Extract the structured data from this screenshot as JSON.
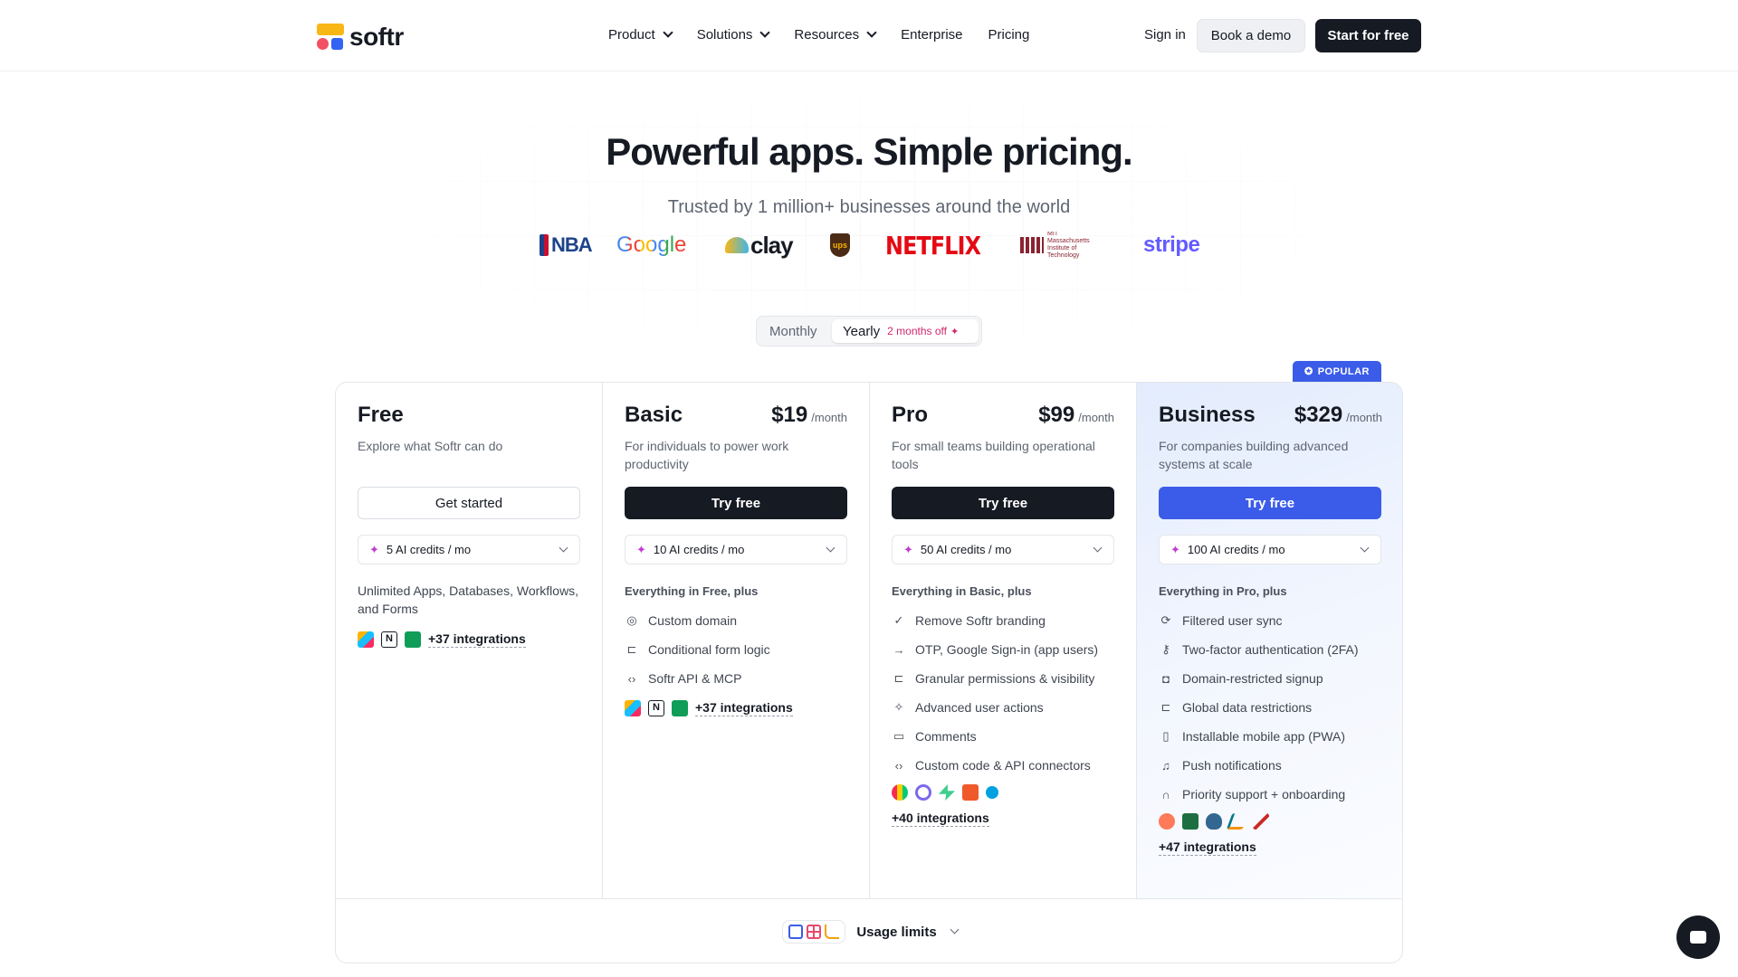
{
  "nav": {
    "logo_text": "softr",
    "menu": [
      {
        "label": "Product",
        "dropdown": true
      },
      {
        "label": "Solutions",
        "dropdown": true
      },
      {
        "label": "Resources",
        "dropdown": true
      },
      {
        "label": "Enterprise",
        "dropdown": false
      },
      {
        "label": "Pricing",
        "dropdown": false
      }
    ],
    "sign_in": "Sign in",
    "book_demo": "Book a demo",
    "start_free": "Start for free"
  },
  "hero": {
    "title": "Powerful apps. Simple pricing.",
    "subtitle": "Trusted by 1 million+ businesses around the world",
    "logos": [
      "NBA",
      "Google",
      "clay",
      "ups",
      "NETFLIX",
      "MIT Massachusetts Institute of Technology",
      "stripe"
    ]
  },
  "billing_toggle": {
    "monthly": "Monthly",
    "yearly": "Yearly",
    "yearly_badge": "2 months off",
    "selected": "Yearly"
  },
  "popular_badge": "POPULAR",
  "plans": [
    {
      "name": "Free",
      "price": "",
      "per": "",
      "description": "Explore what Softr can do",
      "cta": "Get started",
      "credits": "5 AI credits / mo",
      "includes_label": "",
      "summary": "Unlimited Apps, Databases, Workflows, and Forms",
      "features": [],
      "integrations": "+37 integrations"
    },
    {
      "name": "Basic",
      "price": "$19",
      "per": "/month",
      "description": "For individuals to power work productivity",
      "cta": "Try free",
      "credits": "10 AI credits / mo",
      "includes_label": "Everything in Free, plus",
      "features": [
        "Custom domain",
        "Conditional form logic",
        "Softr API & MCP"
      ],
      "integrations": "+37 integrations"
    },
    {
      "name": "Pro",
      "price": "$99",
      "per": "/month",
      "description": "For small teams building operational tools",
      "cta": "Try free",
      "credits": "50 AI credits / mo",
      "includes_label": "Everything in Basic, plus",
      "features": [
        "Remove Softr branding",
        "OTP, Google Sign-in (app users)",
        "Granular permissions & visibility",
        "Advanced user actions",
        "Comments",
        "Custom code & API connectors"
      ],
      "integrations": "+40 integrations"
    },
    {
      "name": "Business",
      "price": "$329",
      "per": "/month",
      "description": "For companies building advanced systems at scale",
      "cta": "Try free",
      "credits": "100 AI credits / mo",
      "includes_label": "Everything in Pro, plus",
      "features": [
        "Filtered user sync",
        "Two-factor authentication (2FA)",
        "Domain-restricted signup",
        "Global data restrictions",
        "Installable mobile app (PWA)",
        "Push notifications",
        "Priority support + onboarding"
      ],
      "integrations": "+47 integrations"
    }
  ],
  "usage_limits": "Usage limits",
  "colors": {
    "brand_dark": "#161a23",
    "brand_blue": "#3b5ce9",
    "accent_pink": "#d1266b",
    "logo_yellow": "#f9b716",
    "logo_red": "#f25164",
    "logo_blue": "#3263f2"
  },
  "icons": {
    "basic_features": [
      "globe-icon",
      "form-logic-icon",
      "code-icon"
    ],
    "pro_features": [
      "badge-check-icon",
      "sign-in-icon",
      "permissions-icon",
      "cursor-click-icon",
      "comments-icon",
      "code-icon"
    ],
    "business_features": [
      "sync-icon",
      "key-icon",
      "lock-icon",
      "restrictions-icon",
      "mobile-icon",
      "bell-icon",
      "headset-icon"
    ]
  }
}
